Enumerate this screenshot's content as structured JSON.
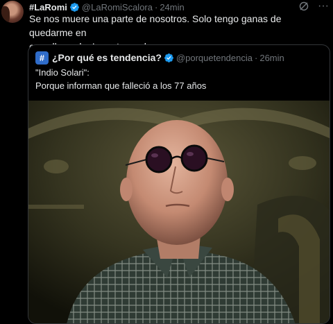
{
  "tweet": {
    "name": "#LaRomi",
    "handle": "@LaRomiScalora",
    "separator": "·",
    "time": "24min",
    "text_line1": "Se nos muere una parte de nosotros. Solo tengo ganas de quedarme en",
    "text_line2": "casa llorando. La puta madre",
    "more_icon": "···",
    "accent": "#1d9bf0"
  },
  "quote": {
    "avatar_glyph": "#",
    "name": "¿Por qué es tendencia?",
    "handle": "@porquetendencia",
    "separator": "·",
    "time": "26min",
    "line1": "\"Indio Solari\":",
    "line2": "Porque informan que falleció a los 77 años"
  }
}
